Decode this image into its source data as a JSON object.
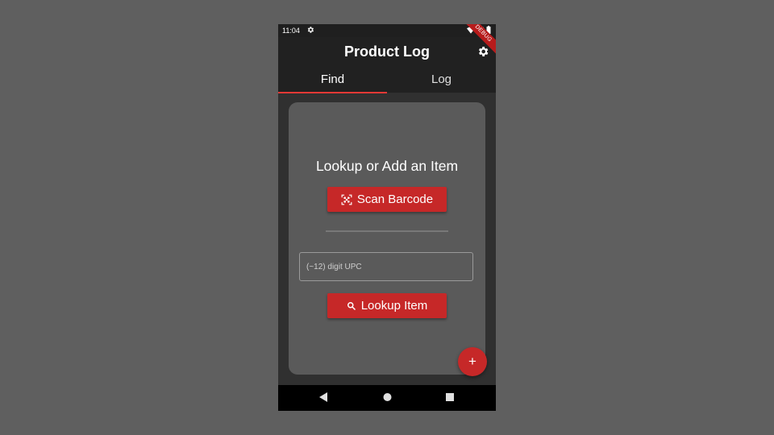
{
  "status_bar": {
    "time": "11:04",
    "debug_banner": "DEBUG"
  },
  "app_bar": {
    "title": "Product Log",
    "settings_icon": "gear-icon"
  },
  "tabs": [
    {
      "label": "Find",
      "active": true
    },
    {
      "label": "Log",
      "active": false
    }
  ],
  "find": {
    "headline": "Lookup or Add an Item",
    "scan_button": {
      "label": "Scan Barcode",
      "icon": "qr-scan-icon"
    },
    "upc_input": {
      "placeholder": "(~12) digit UPC",
      "value": ""
    },
    "lookup_button": {
      "label": "Lookup Item",
      "icon": "search-icon"
    }
  },
  "fab": {
    "label": "+"
  },
  "colors": {
    "accent": "#c62828",
    "tab_indicator": "#e53935",
    "app_bar": "#212121",
    "background": "#303030",
    "card": "#5a5a5a"
  }
}
